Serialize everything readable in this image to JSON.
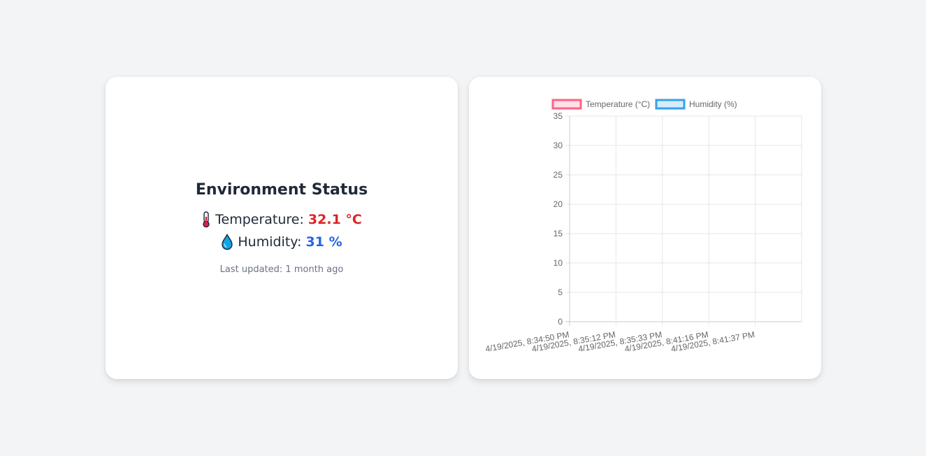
{
  "status": {
    "title": "Environment Status",
    "temperature_label": "Temperature:",
    "temperature_value": "32.1 °C",
    "humidity_label": "Humidity:",
    "humidity_value": "31 %",
    "last_updated": "Last updated: 1 month ago"
  },
  "icons": {
    "temperature": "thermometer-icon",
    "humidity": "droplet-icon"
  },
  "colors": {
    "temperature": "#dc2626",
    "humidity": "#2563eb",
    "temperature_series": "#ff6384",
    "humidity_series": "#36a2eb"
  },
  "chart_data": {
    "type": "line",
    "x": [
      "4/19/2025, 8:34:50 PM",
      "4/19/2025, 8:35:12 PM",
      "4/19/2025, 8:35:33 PM",
      "4/19/2025, 8:41:16 PM",
      "4/19/2025, 8:41:37 PM"
    ],
    "series": [
      {
        "name": "Temperature (°C)",
        "values": []
      },
      {
        "name": "Humidity (%)",
        "values": []
      }
    ],
    "ylim": [
      0,
      35
    ],
    "yticks": [
      0,
      5,
      10,
      15,
      20,
      25,
      30,
      35
    ],
    "grid": true,
    "legend": "top"
  }
}
